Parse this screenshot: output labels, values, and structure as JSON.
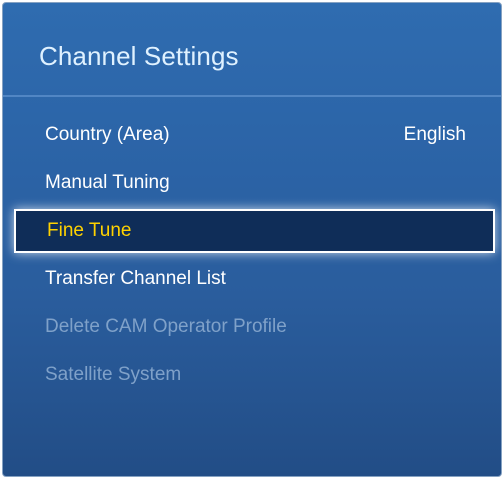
{
  "panel": {
    "title": "Channel Settings",
    "items": [
      {
        "label": "Country (Area)",
        "value": "English",
        "state": "normal"
      },
      {
        "label": "Manual Tuning",
        "state": "normal"
      },
      {
        "label": "Fine Tune",
        "state": "selected"
      },
      {
        "label": "Transfer Channel List",
        "state": "normal"
      },
      {
        "label": "Delete CAM Operator Profile",
        "state": "disabled"
      },
      {
        "label": "Satellite System",
        "state": "disabled"
      }
    ]
  },
  "colors": {
    "background_top": "#2f6cb0",
    "background_bottom": "#224d86",
    "title": "#dff1ff",
    "item_text": "#ffffff",
    "selected_text": "#ffd200",
    "selected_background": "#0f2d58",
    "disabled_text": "#7fa1c9"
  }
}
